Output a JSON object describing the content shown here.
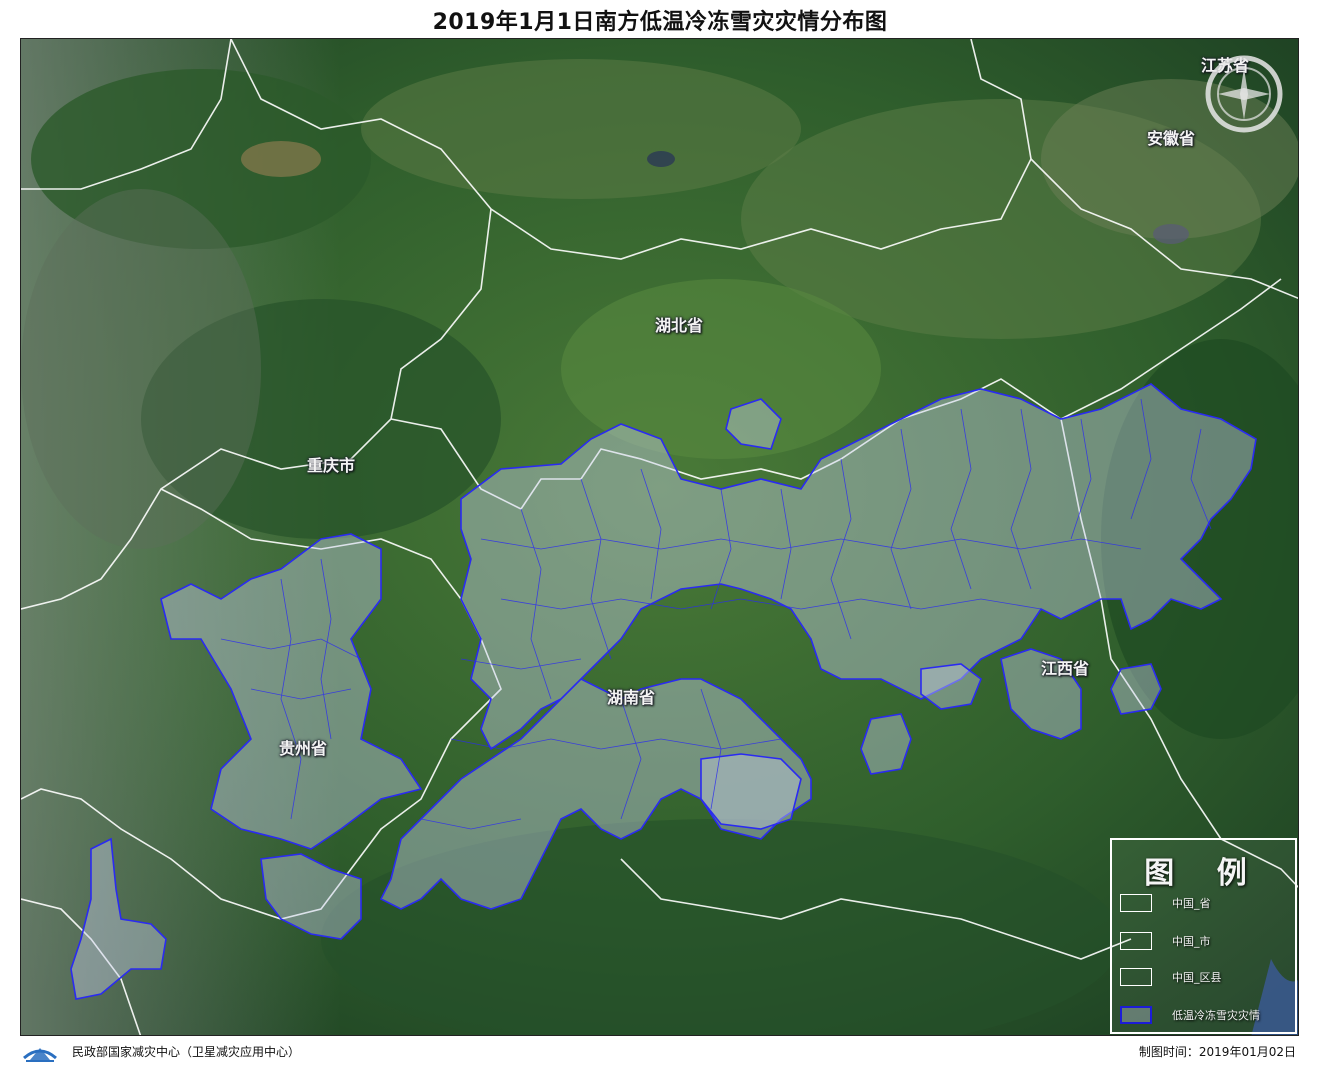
{
  "title": "2019年1月1日南方低温冷冻雪灾灾情分布图",
  "labels": {
    "hubei": "湖北省",
    "chongqing": "重庆市",
    "guizhou": "贵州省",
    "hunan": "湖南省",
    "jiangxi": "江西省",
    "anhui": "安徽省",
    "jiangsu": "江苏省"
  },
  "legend": {
    "title": "图 例",
    "items": [
      {
        "label": "中国_省",
        "type": "province-boundary",
        "color": "#ffffff"
      },
      {
        "label": "中国_市",
        "type": "city-boundary",
        "color": "#ffffff"
      },
      {
        "label": "中国_区县",
        "type": "county-boundary",
        "color": "#ffffff"
      },
      {
        "label": "低温冷冻雪灾灾情",
        "type": "disaster-area",
        "color": "#1c1cd8"
      }
    ]
  },
  "footer": {
    "org": "民政部国家减灾中心（卫星减灾应用中心）",
    "date": "制图时间：2019年01月02日"
  },
  "colors": {
    "disaster_outline": "#2b2bf0",
    "disaster_fill": "#c8cfe8",
    "province_boundary": "#ffffff",
    "terrain_dark": "#1f4a26",
    "terrain_mid": "#3d7032"
  },
  "icons": [
    "north-arrow-icon",
    "logo-icon"
  ]
}
